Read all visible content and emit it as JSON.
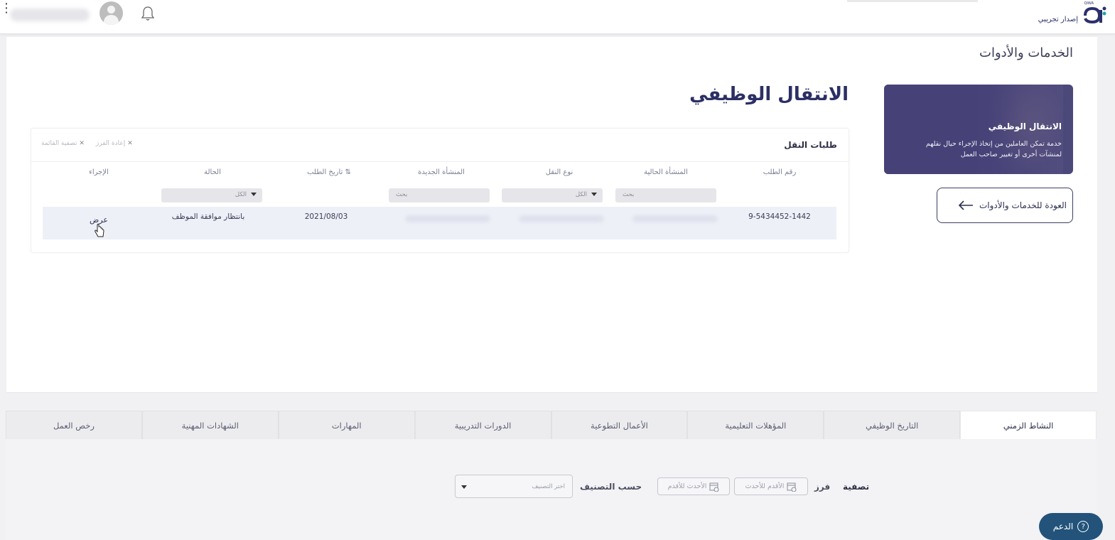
{
  "header": {
    "logo_subtitle": "إصدار تجريبي",
    "logo_tag": "QIWA",
    "user_name": ""
  },
  "page": {
    "heading": "الخدمات والأدوات",
    "service_title": "الانتقال الوظيفي"
  },
  "promo": {
    "title": "الانتقال الوظيفي",
    "description": "خدمة تمكن العاملين من إتخاذ الإجراء حيال نقلهم لمنشآت أخرى أو تغيير صاحب العمل"
  },
  "back_button": {
    "label": "العودة للخدمات والأدوات"
  },
  "table": {
    "title": "طلبات النقل",
    "chips": [
      {
        "label": "إعادة الفرز"
      },
      {
        "label": "تصفية القائمة"
      }
    ],
    "columns": [
      "رقم الطلب",
      "المنشأة الحالية",
      "نوع النقل",
      "المنشأة الجديدة",
      "تاريخ الطلب",
      "الحالة",
      "الإجراء"
    ],
    "filters": {
      "current_est_placeholder": "بحث",
      "transfer_type_value": "الكل",
      "new_est_placeholder": "بحث",
      "status_value": "الكل"
    },
    "rows": [
      {
        "request_no": "9-5434452-1442",
        "date": "2021/08/03",
        "status": "بانتظار موافقة الموظف",
        "action": "عرض"
      }
    ]
  },
  "tabs": [
    {
      "label": "النشاط الزمني",
      "active": true
    },
    {
      "label": "التاريخ الوظيفي",
      "active": false
    },
    {
      "label": "المؤهلات التعليمية",
      "active": false
    },
    {
      "label": "الأعمال التطوعية",
      "active": false
    },
    {
      "label": "الدورات التدريبية",
      "active": false
    },
    {
      "label": "المهارات",
      "active": false
    },
    {
      "label": "الشهادات المهنية",
      "active": false
    },
    {
      "label": "رخص العمل",
      "active": false
    }
  ],
  "filter_bar": {
    "filter_label": "تصفية",
    "sort_label": "فرز",
    "sort_oldest": "الأقدم للأحدث",
    "sort_newest": "الأحدث للأقدم",
    "category_label": "حسب التصنيف",
    "category_placeholder": "اختر التصنيف"
  },
  "support": {
    "label": "الدعم"
  },
  "colors": {
    "brand": "#2c2f63",
    "promo_bg": "#4d4a7a",
    "support_bg": "#23537a",
    "row_highlight": "#edf0f7"
  }
}
